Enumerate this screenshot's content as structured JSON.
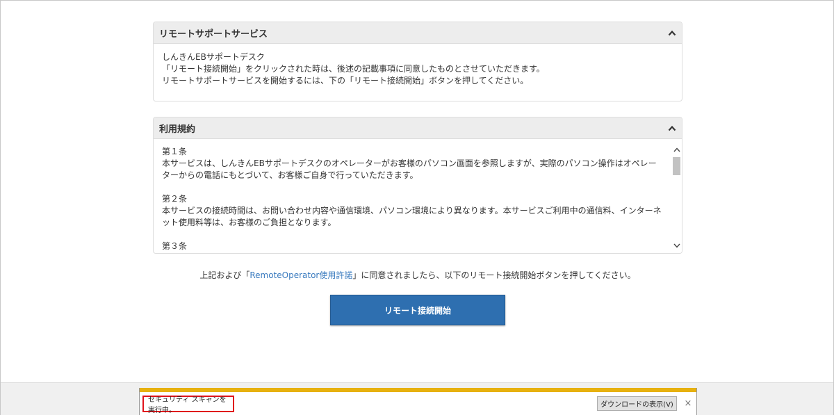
{
  "remote_panel": {
    "title": "リモートサポートサービス",
    "lines": [
      "しんきんEBサポートデスク",
      "「リモート接続開始」をクリックされた時は、後述の記載事項に同意したものとさせていただきます。",
      "リモートサポートサービスを開始するには、下の「リモート接続開始」ボタンを押してください。"
    ]
  },
  "terms_panel": {
    "title": "利用規約",
    "articles": [
      {
        "heading": "第１条",
        "text": "本サービスは、しんきんEBサポートデスクのオペレーターがお客様のパソコン画面を参照しますが、実際のパソコン操作はオペレーターからの電話にもとづいて、お客様ご自身で行っていただきます。"
      },
      {
        "heading": "第２条",
        "text": "本サービスの接続時間は、お問い合わせ内容や通信環境、パソコン環境により異なります。本サービスご利用中の通信料、インターネット使用料等は、お客様のご負担となります。"
      },
      {
        "heading": "第３条",
        "text": ""
      }
    ]
  },
  "consent": {
    "prefix": "上記および「",
    "link": "RemoteOperator使用許諾",
    "suffix": "」に同意されましたら、以下のリモート接続開始ボタンを押してください。"
  },
  "start_button": {
    "label": "リモート接続開始"
  },
  "notification": {
    "status": "セキュリティ スキャンを実行中。",
    "view_button": "ダウンロードの表示(V)",
    "close": "×"
  },
  "colors": {
    "primary_button": "#2e6fb0",
    "link": "#3a7bbf",
    "notification_accent": "#e7b10f",
    "highlight_box": "#e0131b"
  }
}
